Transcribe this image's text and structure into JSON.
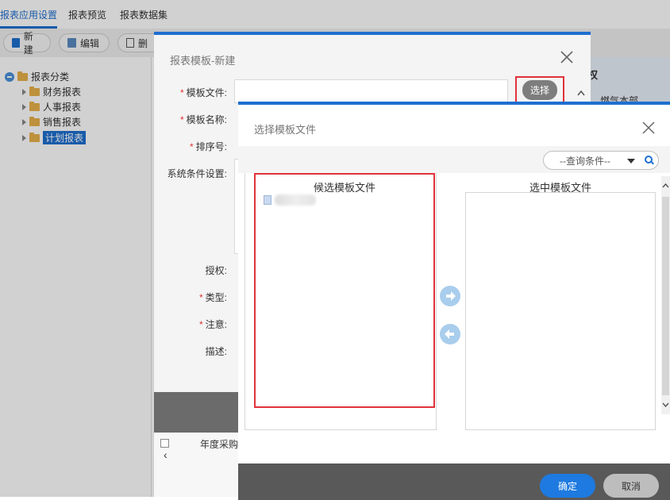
{
  "app": {
    "tabs": [
      "报表应用设置",
      "报表预览",
      "报表数据集"
    ],
    "toolbar": {
      "new_label": "新建",
      "edit_label": "编辑",
      "delete_label": "删"
    },
    "tree": {
      "root": "报表分类",
      "items": [
        "财务报表",
        "人事报表",
        "销售报表",
        "计划报表"
      ]
    },
    "grid_header_right": "权",
    "grid_cell_right": "燃气本部",
    "grid_bottom_text": "年度采购"
  },
  "dialog_new": {
    "title": "报表模板-新建",
    "fields": {
      "template_file": "模板文件:",
      "template_name": "模板名称:",
      "sort_no": "排序号:",
      "sys_cond": "系统条件设置:",
      "auth": "授权:",
      "type": "类型:",
      "note": "注意:",
      "desc": "描述:"
    },
    "select_button": "选择"
  },
  "dialog_select": {
    "title": "选择模板文件",
    "query_placeholder": "--查询条件--",
    "candidate_header": "候选模板文件",
    "selected_header": "选中模板文件",
    "ok_label": "确定",
    "cancel_label": "取消"
  },
  "colors": {
    "accent": "#1e6fd0",
    "highlight_frame": "#e0323a"
  }
}
